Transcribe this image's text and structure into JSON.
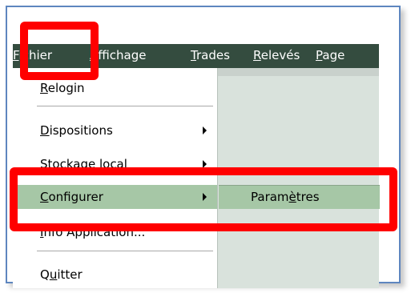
{
  "menubar": {
    "items": [
      {
        "label": "Fichier"
      },
      {
        "label": "Affichage"
      },
      {
        "label": "Trades"
      },
      {
        "label": "Relevés"
      },
      {
        "label": "Page"
      }
    ]
  },
  "file_menu": {
    "items": [
      {
        "label": "Relogin",
        "has_submenu": false
      },
      {
        "label": "Dispositions",
        "has_submenu": true
      },
      {
        "label": "Stockage local",
        "has_submenu": true
      },
      {
        "label": "Configurer",
        "has_submenu": true,
        "selected": true
      },
      {
        "label": "Info Application...",
        "has_submenu": false
      },
      {
        "label": "Quitter",
        "has_submenu": false
      }
    ]
  },
  "submenu": {
    "items": [
      {
        "label": "Paramètres"
      }
    ]
  },
  "colors": {
    "frame_border": "#5e86bf",
    "menubar_bg": "#344c3f",
    "selected_bg": "#a6c7a6",
    "highlight": "#ff0000"
  }
}
